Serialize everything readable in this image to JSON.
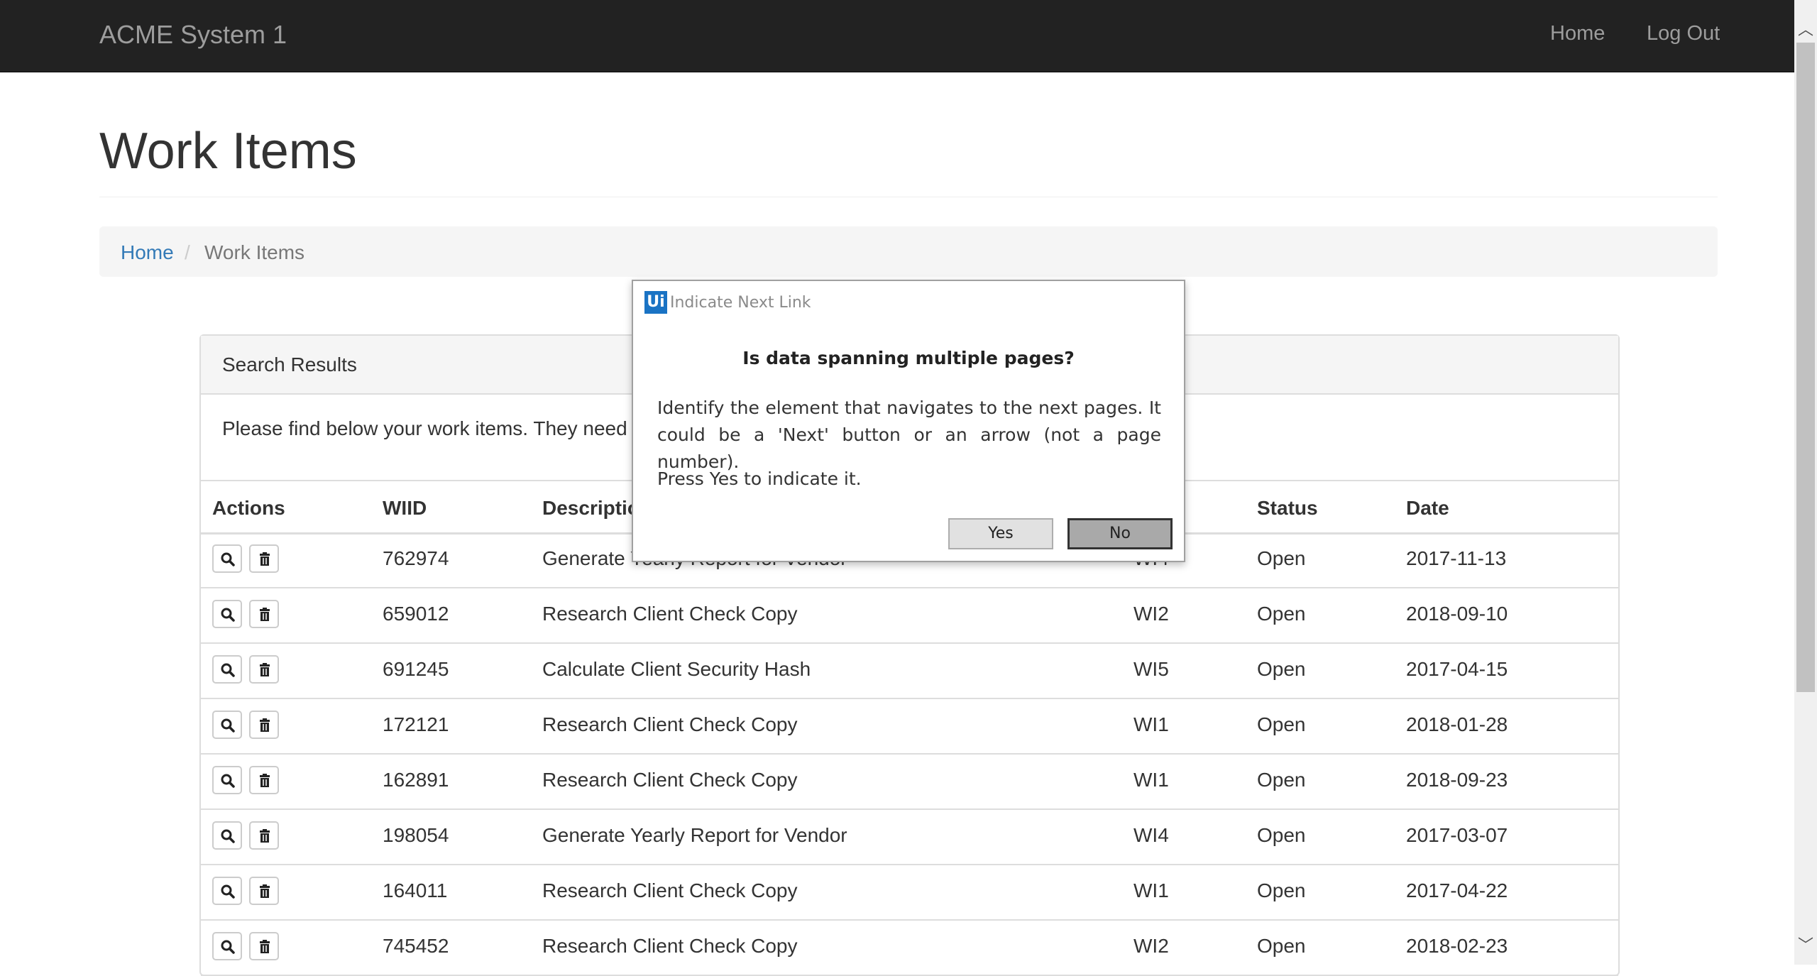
{
  "navbar": {
    "brand": "ACME System 1",
    "links": [
      "Home",
      "Log Out"
    ]
  },
  "page": {
    "title": "Work Items"
  },
  "breadcrumb": {
    "home": "Home",
    "separator": "/",
    "current": "Work Items"
  },
  "panel": {
    "title": "Search Results",
    "body": "Please find below your work items. They need"
  },
  "table": {
    "headers": [
      "Actions",
      "WIID",
      "Descriptio",
      "Status",
      "Date"
    ],
    "rows": [
      {
        "wiid": "762974",
        "description": "Generate Yearly Report for Vendor",
        "type": "WI4",
        "status": "Open",
        "date": "2017-11-13"
      },
      {
        "wiid": "659012",
        "description": "Research Client Check Copy",
        "type": "WI2",
        "status": "Open",
        "date": "2018-09-10"
      },
      {
        "wiid": "691245",
        "description": "Calculate Client Security Hash",
        "type": "WI5",
        "status": "Open",
        "date": "2017-04-15"
      },
      {
        "wiid": "172121",
        "description": "Research Client Check Copy",
        "type": "WI1",
        "status": "Open",
        "date": "2018-01-28"
      },
      {
        "wiid": "162891",
        "description": "Research Client Check Copy",
        "type": "WI1",
        "status": "Open",
        "date": "2018-09-23"
      },
      {
        "wiid": "198054",
        "description": "Generate Yearly Report for Vendor",
        "type": "WI4",
        "status": "Open",
        "date": "2017-03-07"
      },
      {
        "wiid": "164011",
        "description": "Research Client Check Copy",
        "type": "WI1",
        "status": "Open",
        "date": "2017-04-22"
      },
      {
        "wiid": "745452",
        "description": "Research Client Check Copy",
        "type": "WI2",
        "status": "Open",
        "date": "2018-02-23"
      }
    ]
  },
  "dialog": {
    "logo": "Ui",
    "title": "Indicate Next Link",
    "heading": "Is data spanning multiple pages?",
    "text": "Identify the element that navigates to the next pages. It could be a 'Next' button or an arrow (not a page number).",
    "text2": "Press Yes to indicate it.",
    "yes": "Yes",
    "no": "No"
  }
}
